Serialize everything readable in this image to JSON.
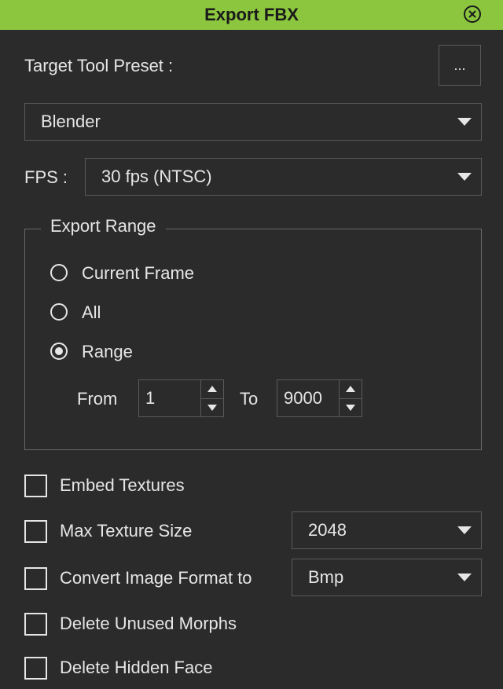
{
  "window": {
    "title": "Export FBX"
  },
  "preset": {
    "label": "Target Tool Preset :",
    "button_label": "...",
    "selected": "Blender"
  },
  "fps": {
    "label": "FPS :",
    "selected": "30 fps (NTSC)"
  },
  "export_range": {
    "title": "Export Range",
    "options": [
      {
        "label": "Current Frame",
        "checked": false
      },
      {
        "label": "All",
        "checked": false
      },
      {
        "label": "Range",
        "checked": true
      }
    ],
    "from_label": "From",
    "from_value": "1",
    "to_label": "To",
    "to_value": "9000"
  },
  "options": {
    "embed_textures": {
      "label": "Embed Textures",
      "checked": false
    },
    "max_texture_size": {
      "label": "Max Texture Size",
      "checked": false,
      "value": "2048"
    },
    "convert_image_format": {
      "label": "Convert Image Format to",
      "checked": false,
      "value": "Bmp"
    },
    "delete_unused_morphs": {
      "label": "Delete Unused Morphs",
      "checked": false
    },
    "delete_hidden_face": {
      "label": "Delete Hidden Face",
      "checked": false
    }
  },
  "colors": {
    "titlebar": "#8cc63f",
    "background": "#2b2b2b",
    "text": "#e6e6e6",
    "border": "#5a5a5a"
  },
  "icons": {
    "close": "close-circle-icon",
    "dropdown": "chevron-down-icon"
  }
}
